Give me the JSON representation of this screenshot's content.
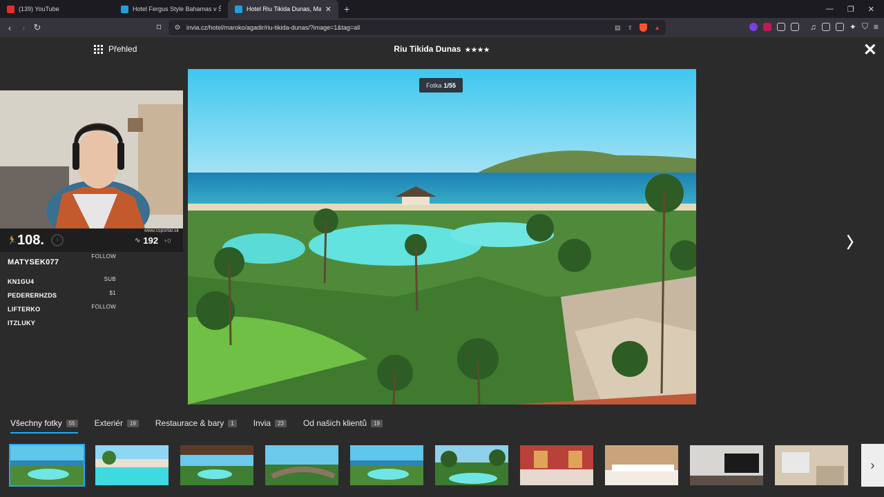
{
  "browser": {
    "tabs": [
      {
        "title": "(139) YouTube",
        "color": "#e52d27"
      },
      {
        "title": "Hotel Fergus Style Bahamas v Španě...",
        "color": "#1ea0db"
      },
      {
        "title": "Hotel Riu Tikida Dunas, Maroko",
        "color": "#1ea0db",
        "active": true
      }
    ],
    "new_tab": "+",
    "url": "invia.cz/hotel/maroko/agadir/riu-tikida-dunas/?image=1&tag=all",
    "window_controls": [
      "—",
      "❐",
      "✕"
    ]
  },
  "gallery": {
    "overview_label": "Přehled",
    "hotel_title": "Riu Tikida Dunas",
    "stars": "★★★★",
    "photo_counter_prefix": "Fotka",
    "photo_counter_value": "1/55",
    "close": "✕",
    "next": "〉"
  },
  "stream_overlay": {
    "rank": "108.",
    "site": "www.csportal.sk",
    "viewers": "192",
    "viewers_delta": "+0",
    "rows": [
      {
        "name": "MATYSEK077",
        "tag": "FOLLOW"
      },
      {
        "name": "KN1GU4",
        "tag": "SUB"
      },
      {
        "name": "PEDERERHZDS",
        "tag": "$1"
      },
      {
        "name": "LIFTERKO",
        "tag": "FOLLOW"
      },
      {
        "name": "ITZLUKY",
        "tag": ""
      }
    ]
  },
  "photo_tabs": [
    {
      "label": "Všechny fotky",
      "count": "55",
      "active": true
    },
    {
      "label": "Exteriér",
      "count": "19"
    },
    {
      "label": "Restaurace & bary",
      "count": "1"
    },
    {
      "label": "Invia",
      "count": "23"
    },
    {
      "label": "Od našich klientů",
      "count": "19"
    }
  ],
  "thumbnails": [
    {
      "kind": "resort-pool",
      "active": true
    },
    {
      "kind": "pool"
    },
    {
      "kind": "resort-terrace"
    },
    {
      "kind": "bridge"
    },
    {
      "kind": "resort-pool"
    },
    {
      "kind": "palms"
    },
    {
      "kind": "restaurant"
    },
    {
      "kind": "bedroom"
    },
    {
      "kind": "room-tv"
    },
    {
      "kind": "bathroom"
    }
  ],
  "thumb_next": "›"
}
